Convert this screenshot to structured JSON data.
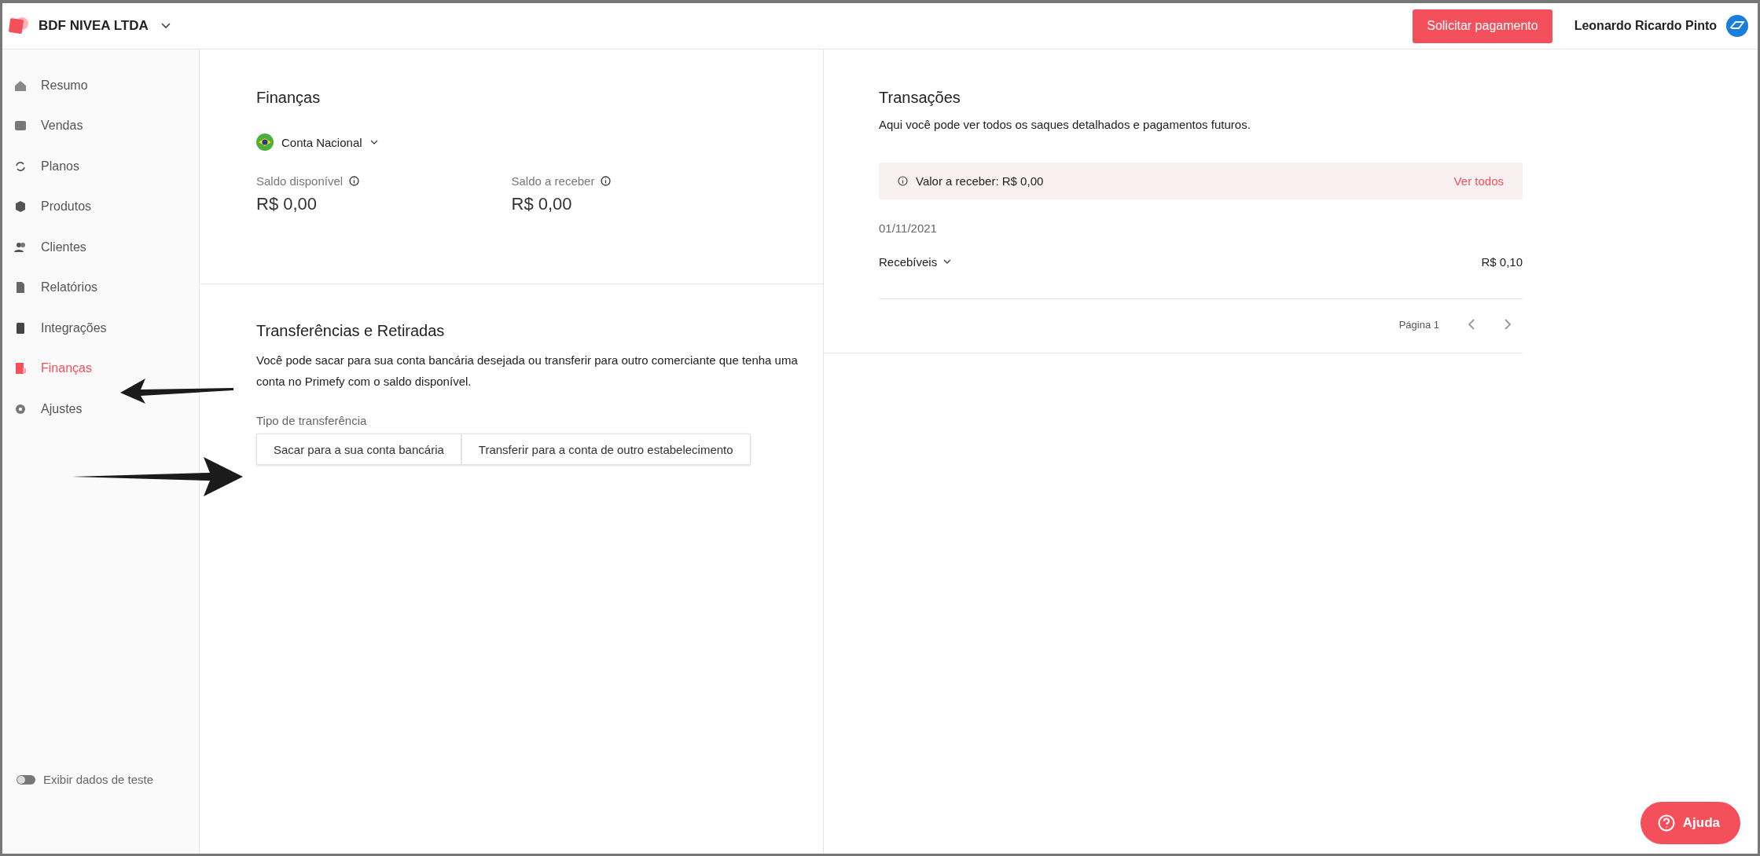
{
  "header": {
    "company": "BDF NIVEA LTDA",
    "action_button": "Solicitar pagamento",
    "user_name": "Leonardo Ricardo Pinto"
  },
  "sidebar": {
    "items": [
      {
        "label": "Resumo",
        "selected": false
      },
      {
        "label": "Vendas",
        "selected": false
      },
      {
        "label": "Planos",
        "selected": false
      },
      {
        "label": "Produtos",
        "selected": false
      },
      {
        "label": "Clientes",
        "selected": false
      },
      {
        "label": "Relatórios",
        "selected": false
      },
      {
        "label": "Integrações",
        "selected": false
      },
      {
        "label": "Finanças",
        "selected": true
      },
      {
        "label": "Ajustes",
        "selected": false
      }
    ],
    "test_data_toggle": {
      "label": "Exibir dados de teste",
      "on": false
    }
  },
  "finances": {
    "title": "Finanças",
    "account": "Conta Nacional",
    "balances": [
      {
        "label": "Saldo disponível",
        "value": "R$ 0,00"
      },
      {
        "label": "Saldo a receber",
        "value": "R$ 0,00"
      }
    ]
  },
  "transfers": {
    "title": "Transferências e Retiradas",
    "description": "Você pode sacar para sua conta bancária desejada ou transferir para outro comerciante que tenha uma conta no Primefy com o saldo disponível.",
    "type_label": "Tipo de transferência",
    "options": [
      {
        "label": "Sacar para a sua conta bancária",
        "selected": false
      },
      {
        "label": "Transferir para a conta de outro estabelecimento",
        "selected": false
      }
    ]
  },
  "transactions": {
    "title": "Transações",
    "description": "Aqui você pode ver todos os saques detalhados e pagamentos futuros.",
    "notice": "Valor a receber: R$ 0,00",
    "notice_link": "Ver todos",
    "groups": [
      {
        "date": "01/11/2021",
        "label": "Recebíveis",
        "amount": "R$ 0,10"
      }
    ],
    "pagination": {
      "label": "Página 1"
    }
  },
  "help_button": "Ajuda"
}
